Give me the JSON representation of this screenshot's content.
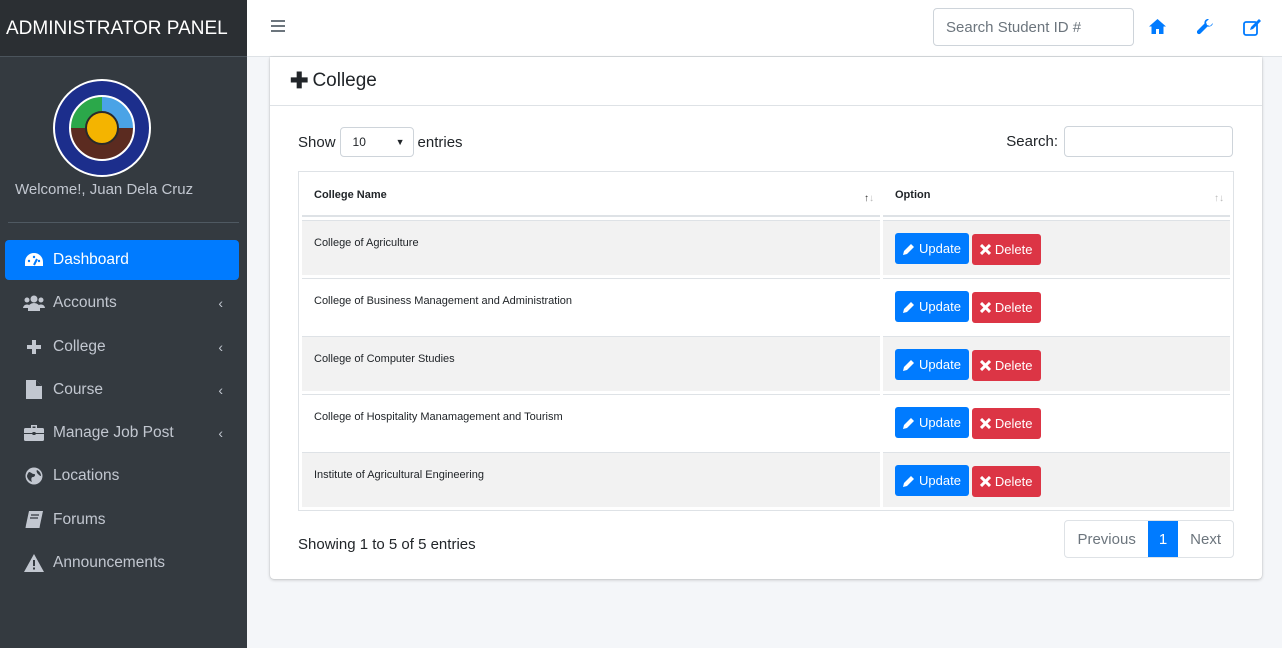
{
  "sidebar": {
    "brand": "ADMINISTRATOR PANEL",
    "welcome": "Welcome!, Juan Dela Cruz",
    "items": [
      {
        "label": "Dashboard",
        "icon": "tachometer-icon",
        "active": true,
        "has_submenu": false
      },
      {
        "label": "Accounts",
        "icon": "users-icon",
        "active": false,
        "has_submenu": true
      },
      {
        "label": "College",
        "icon": "plus-icon",
        "active": false,
        "has_submenu": true
      },
      {
        "label": "Course",
        "icon": "file-icon",
        "active": false,
        "has_submenu": true
      },
      {
        "label": "Manage Job Post",
        "icon": "briefcase-icon",
        "active": false,
        "has_submenu": true
      },
      {
        "label": "Locations",
        "icon": "globe-icon",
        "active": false,
        "has_submenu": false
      },
      {
        "label": "Forums",
        "icon": "book-icon",
        "active": false,
        "has_submenu": false
      },
      {
        "label": "Announcements",
        "icon": "warning-icon",
        "active": false,
        "has_submenu": false
      }
    ]
  },
  "topbar": {
    "student_search_placeholder": "Search Student ID #",
    "icons": [
      "home-icon",
      "wrench-icon",
      "edit-icon"
    ],
    "accent": "#007bff"
  },
  "card": {
    "title": "College",
    "show_label": "Show",
    "entries_label": "entries",
    "page_length": "10",
    "search_label": "Search:",
    "search_value": "",
    "columns": [
      "College Name",
      "Option"
    ],
    "rows": [
      {
        "name": "College of Agriculture"
      },
      {
        "name": "College of Business Management and Administration"
      },
      {
        "name": "College of Computer Studies"
      },
      {
        "name": "College of Hospitality Manamagement and Tourism"
      },
      {
        "name": "Institute of Agricultural Engineering"
      }
    ],
    "update_label": "Update",
    "delete_label": "Delete",
    "info": "Showing 1 to 5 of 5 entries",
    "pagination": {
      "previous": "Previous",
      "current": "1",
      "next": "Next"
    }
  }
}
